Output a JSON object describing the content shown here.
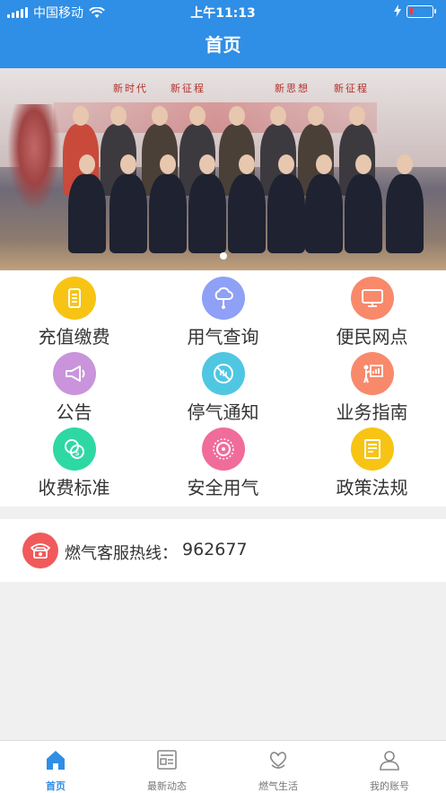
{
  "status_bar": {
    "carrier": "中国移动",
    "time": "上午11:13",
    "battery_level": 0.15
  },
  "navbar": {
    "title": "首页"
  },
  "banner": {
    "slogans": [
      "新时代",
      "新征程",
      "新思想",
      "新征程"
    ],
    "page_count": 1,
    "active_index": 0
  },
  "menu": {
    "items": [
      {
        "label": "充值缴费",
        "icon": "phone-payment-icon",
        "color": "#f7c414"
      },
      {
        "label": "用气查询",
        "icon": "cloud-query-icon",
        "color": "#8fa0f7"
      },
      {
        "label": "便民网点",
        "icon": "monitor-icon",
        "color": "#f9896b"
      },
      {
        "label": "公告",
        "icon": "megaphone-icon",
        "color": "#c994db"
      },
      {
        "label": "停气通知",
        "icon": "no-gas-icon",
        "color": "#4fc7e2"
      },
      {
        "label": "业务指南",
        "icon": "presentation-icon",
        "color": "#f9896b"
      },
      {
        "label": "收费标准",
        "icon": "coins-icon",
        "color": "#2ed8a3"
      },
      {
        "label": "安全用气",
        "icon": "safety-dial-icon",
        "color": "#f06c9b"
      },
      {
        "label": "政策法规",
        "icon": "document-icon",
        "color": "#f7c414"
      }
    ]
  },
  "hotline": {
    "label": "燃气客服热线：",
    "number": "962677",
    "icon_color": "#f05a5a"
  },
  "tabbar": {
    "tabs": [
      {
        "label": "首页",
        "icon": "home-icon",
        "active": true
      },
      {
        "label": "最新动态",
        "icon": "news-icon",
        "active": false
      },
      {
        "label": "燃气生活",
        "icon": "heart-hand-icon",
        "active": false
      },
      {
        "label": "我的账号",
        "icon": "user-icon",
        "active": false
      }
    ],
    "accent": "#2f8ee5"
  }
}
